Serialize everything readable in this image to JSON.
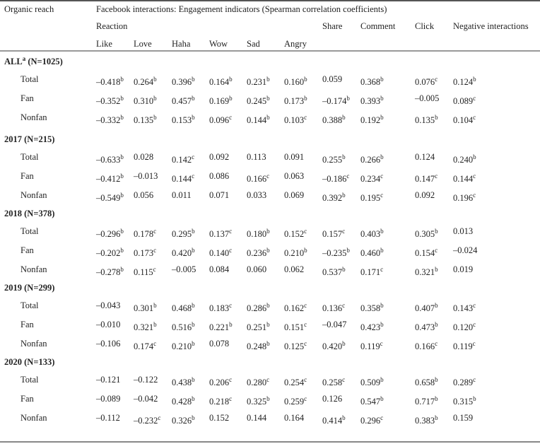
{
  "header": {
    "stub": "Organic reach",
    "spanner": "Facebook interactions: Engagement indicators (Spearman correlation coefficients)",
    "reaction": "Reaction",
    "columns": [
      "Like",
      "Love",
      "Haha",
      "Wow",
      "Sad",
      "Angry",
      "Share",
      "Comment",
      "Click",
      "Negative interactions"
    ]
  },
  "groups": [
    {
      "label": "ALL",
      "label_sup": "a",
      "label_n": " (N=1025)",
      "rows": [
        {
          "label": "Total",
          "cells": [
            [
              "–0.418",
              "b"
            ],
            [
              "0.264",
              "b"
            ],
            [
              "0.396",
              "b"
            ],
            [
              "0.164",
              "b"
            ],
            [
              "0.231",
              "b"
            ],
            [
              "0.160",
              "b"
            ],
            [
              "0.059",
              ""
            ],
            [
              "0.368",
              "b"
            ],
            [
              "0.076",
              "c"
            ],
            [
              "0.124",
              "b"
            ]
          ]
        },
        {
          "label": "Fan",
          "cells": [
            [
              "–0.352",
              "b"
            ],
            [
              "0.310",
              "b"
            ],
            [
              "0.457",
              "b"
            ],
            [
              "0.169",
              "b"
            ],
            [
              "0.245",
              "b"
            ],
            [
              "0.173",
              "b"
            ],
            [
              "–0.174",
              "b"
            ],
            [
              "0.393",
              "b"
            ],
            [
              "–0.005",
              ""
            ],
            [
              "0.089",
              "c"
            ]
          ]
        },
        {
          "label": "Nonfan",
          "cells": [
            [
              "–0.332",
              "b"
            ],
            [
              "0.135",
              "b"
            ],
            [
              "0.153",
              "b"
            ],
            [
              "0.096",
              "c"
            ],
            [
              "0.144",
              "b"
            ],
            [
              "0.103",
              "c"
            ],
            [
              "0.388",
              "b"
            ],
            [
              "0.192",
              "b"
            ],
            [
              "0.135",
              "b"
            ],
            [
              "0.104",
              "c"
            ]
          ]
        }
      ]
    },
    {
      "label": "2017",
      "label_sup": "",
      "label_n": " (N=215)",
      "rows": [
        {
          "label": "Total",
          "cells": [
            [
              "–0.633",
              "b"
            ],
            [
              "0.028",
              ""
            ],
            [
              "0.142",
              "c"
            ],
            [
              "0.092",
              ""
            ],
            [
              "0.113",
              ""
            ],
            [
              "0.091",
              ""
            ],
            [
              "0.255",
              "b"
            ],
            [
              "0.266",
              "b"
            ],
            [
              "0.124",
              ""
            ],
            [
              "0.240",
              "b"
            ]
          ]
        },
        {
          "label": "Fan",
          "cells": [
            [
              "–0.412",
              "b"
            ],
            [
              "–0.013",
              ""
            ],
            [
              "0.144",
              "c"
            ],
            [
              "0.086",
              ""
            ],
            [
              "0.166",
              "c"
            ],
            [
              "0.063",
              ""
            ],
            [
              "–0.186",
              "c"
            ],
            [
              "0.234",
              "c"
            ],
            [
              "0.147",
              "c"
            ],
            [
              "0.144",
              "c"
            ]
          ]
        },
        {
          "label": "Nonfan",
          "cells": [
            [
              "–0.549",
              "b"
            ],
            [
              "0.056",
              ""
            ],
            [
              "0.011",
              ""
            ],
            [
              "0.071",
              ""
            ],
            [
              "0.033",
              ""
            ],
            [
              "0.069",
              ""
            ],
            [
              "0.392",
              "b"
            ],
            [
              "0.195",
              "c"
            ],
            [
              "0.092",
              ""
            ],
            [
              "0.196",
              "c"
            ]
          ]
        }
      ]
    },
    {
      "label": "2018",
      "label_sup": "",
      "label_n": " (N=378)",
      "rows": [
        {
          "label": "Total",
          "cells": [
            [
              "–0.296",
              "b"
            ],
            [
              "0.178",
              "c"
            ],
            [
              "0.295",
              "b"
            ],
            [
              "0.137",
              "c"
            ],
            [
              "0.180",
              "b"
            ],
            [
              "0.152",
              "c"
            ],
            [
              "0.157",
              "c"
            ],
            [
              "0.403",
              "b"
            ],
            [
              "0.305",
              "b"
            ],
            [
              "0.013",
              ""
            ]
          ]
        },
        {
          "label": "Fan",
          "cells": [
            [
              "–0.202",
              "b"
            ],
            [
              "0.173",
              "c"
            ],
            [
              "0.420",
              "b"
            ],
            [
              "0.140",
              "c"
            ],
            [
              "0.236",
              "b"
            ],
            [
              "0.210",
              "b"
            ],
            [
              "–0.235",
              "b"
            ],
            [
              "0.460",
              "b"
            ],
            [
              "0.154",
              "c"
            ],
            [
              "–0.024",
              ""
            ]
          ]
        },
        {
          "label": "Nonfan",
          "cells": [
            [
              "–0.278",
              "b"
            ],
            [
              "0.115",
              "c"
            ],
            [
              "–0.005",
              ""
            ],
            [
              "0.084",
              ""
            ],
            [
              "0.060",
              ""
            ],
            [
              "0.062",
              ""
            ],
            [
              "0.537",
              "b"
            ],
            [
              "0.171",
              "c"
            ],
            [
              "0.321",
              "b"
            ],
            [
              "0.019",
              ""
            ]
          ]
        }
      ]
    },
    {
      "label": "2019",
      "label_sup": "",
      "label_n": " (N=299)",
      "rows": [
        {
          "label": "Total",
          "cells": [
            [
              "–0.043",
              ""
            ],
            [
              "0.301",
              "b"
            ],
            [
              "0.468",
              "b"
            ],
            [
              "0.183",
              "c"
            ],
            [
              "0.286",
              "b"
            ],
            [
              "0.162",
              "c"
            ],
            [
              "0.136",
              "c"
            ],
            [
              "0.358",
              "b"
            ],
            [
              "0.407",
              "b"
            ],
            [
              "0.143",
              "c"
            ]
          ]
        },
        {
          "label": "Fan",
          "cells": [
            [
              "–0.010",
              ""
            ],
            [
              "0.321",
              "b"
            ],
            [
              "0.516",
              "b"
            ],
            [
              "0.221",
              "b"
            ],
            [
              "0.251",
              "b"
            ],
            [
              "0.151",
              "c"
            ],
            [
              "–0.047",
              ""
            ],
            [
              "0.423",
              "b"
            ],
            [
              "0.473",
              "b"
            ],
            [
              "0.120",
              "c"
            ]
          ]
        },
        {
          "label": "Nonfan",
          "cells": [
            [
              "–0.106",
              ""
            ],
            [
              "0.174",
              "c"
            ],
            [
              "0.210",
              "b"
            ],
            [
              "0.078",
              ""
            ],
            [
              "0.248",
              "b"
            ],
            [
              "0.125",
              "c"
            ],
            [
              "0.420",
              "b"
            ],
            [
              "0.119",
              "c"
            ],
            [
              "0.166",
              "c"
            ],
            [
              "0.119",
              "c"
            ]
          ]
        }
      ]
    },
    {
      "label": "2020",
      "label_sup": "",
      "label_n": " (N=133)",
      "rows": [
        {
          "label": "Total",
          "cells": [
            [
              "–0.121",
              ""
            ],
            [
              "–0.122",
              ""
            ],
            [
              "0.438",
              "b"
            ],
            [
              "0.206",
              "c"
            ],
            [
              "0.280",
              "c"
            ],
            [
              "0.254",
              "c"
            ],
            [
              "0.258",
              "c"
            ],
            [
              "0.509",
              "b"
            ],
            [
              "0.658",
              "b"
            ],
            [
              "0.289",
              "c"
            ]
          ]
        },
        {
          "label": "Fan",
          "cells": [
            [
              "–0.089",
              ""
            ],
            [
              "–0.042",
              ""
            ],
            [
              "0.428",
              "b"
            ],
            [
              "0.218",
              "c"
            ],
            [
              "0.325",
              "b"
            ],
            [
              "0.259",
              "c"
            ],
            [
              "0.126",
              ""
            ],
            [
              "0.547",
              "b"
            ],
            [
              "0.717",
              "b"
            ],
            [
              "0.315",
              "b"
            ]
          ]
        },
        {
          "label": "Nonfan",
          "cells": [
            [
              "–0.112",
              ""
            ],
            [
              "–0.232",
              "c"
            ],
            [
              "0.326",
              "b"
            ],
            [
              "0.152",
              ""
            ],
            [
              "0.144",
              ""
            ],
            [
              "0.164",
              ""
            ],
            [
              "0.414",
              "b"
            ],
            [
              "0.296",
              "c"
            ],
            [
              "0.383",
              "b"
            ],
            [
              "0.159",
              ""
            ]
          ]
        }
      ]
    }
  ]
}
